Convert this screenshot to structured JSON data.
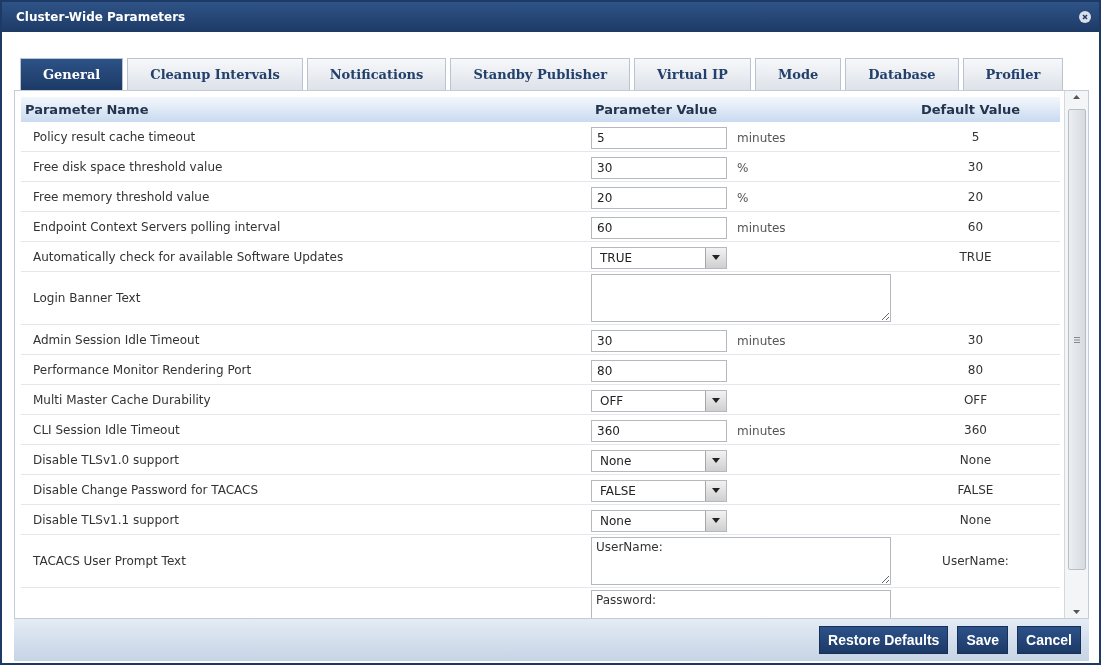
{
  "window": {
    "title": "Cluster-Wide Parameters"
  },
  "tabs": [
    {
      "label": "General",
      "selected": true
    },
    {
      "label": "Cleanup Intervals",
      "selected": false
    },
    {
      "label": "Notifications",
      "selected": false
    },
    {
      "label": "Standby Publisher",
      "selected": false
    },
    {
      "label": "Virtual IP",
      "selected": false
    },
    {
      "label": "Mode",
      "selected": false
    },
    {
      "label": "Database",
      "selected": false
    },
    {
      "label": "Profiler",
      "selected": false
    }
  ],
  "table": {
    "columns": [
      "Parameter Name",
      "Parameter Value",
      "Default Value"
    ],
    "rows": [
      {
        "name": "Policy result cache timeout",
        "kind": "input",
        "value": "5",
        "unit": "minutes",
        "default": "5"
      },
      {
        "name": "Free disk space threshold value",
        "kind": "input",
        "value": "30",
        "unit": "%",
        "default": "30"
      },
      {
        "name": "Free memory threshold value",
        "kind": "input",
        "value": "20",
        "unit": "%",
        "default": "20"
      },
      {
        "name": "Endpoint Context Servers polling interval",
        "kind": "input",
        "value": "60",
        "unit": "minutes",
        "default": "60"
      },
      {
        "name": "Automatically check for available Software Updates",
        "kind": "select",
        "value": "TRUE",
        "default": "TRUE"
      },
      {
        "name": "Login Banner Text",
        "kind": "textarea"
      },
      {
        "name": "Admin Session Idle Timeout",
        "kind": "input",
        "value": "30",
        "unit": "minutes",
        "default": "30"
      },
      {
        "name": "Performance Monitor Rendering Port",
        "kind": "input",
        "value": "80",
        "default": "80"
      },
      {
        "name": "Multi Master Cache Durability",
        "kind": "select",
        "value": "OFF",
        "default": "OFF"
      },
      {
        "name": "CLI Session Idle Timeout",
        "kind": "input",
        "value": "360",
        "unit": "minutes",
        "default": "360"
      },
      {
        "name": "Disable TLSv1.0 support",
        "kind": "select",
        "value": "None",
        "default": "None"
      },
      {
        "name": "Disable Change Password for TACACS",
        "kind": "select",
        "value": "FALSE",
        "default": "FALSE"
      },
      {
        "name": "Disable TLSv1.1 support",
        "kind": "select",
        "value": "None",
        "default": "None"
      },
      {
        "name": "TACACS User Prompt Text",
        "kind": "textarea",
        "value": "UserName:",
        "default": "UserName:"
      },
      {
        "kind": "textarea",
        "value": "Password:"
      }
    ]
  },
  "buttons": [
    "Restore Defaults",
    "Save",
    "Cancel"
  ]
}
